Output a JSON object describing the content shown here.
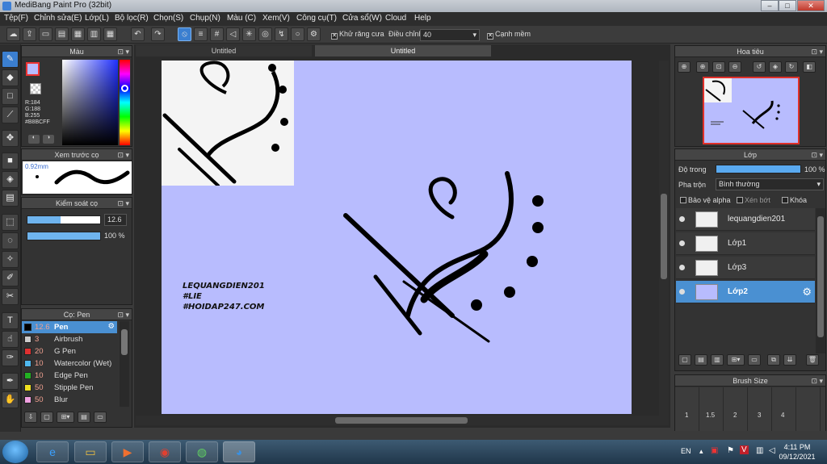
{
  "window": {
    "title": "MediBang Paint Pro (32bit)",
    "min": "–",
    "max": "□",
    "close": "✕"
  },
  "menu": [
    "Tệp(F)",
    "Chỉnh sửa(E)",
    "Lớp(L)",
    "Bộ lọc(R)",
    "Chọn(S)",
    "Chụp(N)",
    "Màu (C)",
    "Xem(V)",
    "Công cụ(T)",
    "Cửa sổ(W)",
    "Cloud",
    "Help"
  ],
  "toolbar": {
    "antialias_label": "Khử răng cưa",
    "adjust_label": "Điều chỉnh",
    "adjust_value": "40",
    "edge_label": "Cạnh mềm"
  },
  "color_panel": {
    "title": "Màu",
    "r": "R:184",
    "g": "G:188",
    "b": "B:255",
    "hex": "#B8BCFF",
    "primary_color": "#B8BCFF"
  },
  "preview_panel": {
    "title": "Xem trước cọ",
    "size": "0.92mm"
  },
  "brush_control": {
    "title": "Kiểm soát cọ",
    "size_value": "12.6",
    "opacity_value": "100 %",
    "size_fill": 0.45,
    "opacity_fill": 1.0
  },
  "brush_panel": {
    "title": "Cọ: Pen",
    "items": [
      {
        "size": "12.6",
        "name": "Pen",
        "color": "#000000"
      },
      {
        "size": "3",
        "name": "Airbrush",
        "color": "#cccccc"
      },
      {
        "size": "20",
        "name": "G Pen",
        "color": "#e03030"
      },
      {
        "size": "10",
        "name": "Watercolor (Wet)",
        "color": "#4fb8f0"
      },
      {
        "size": "10",
        "name": "Edge Pen",
        "color": "#22b022"
      },
      {
        "size": "50",
        "name": "Stipple Pen",
        "color": "#f0e020"
      },
      {
        "size": "50",
        "name": "Blur",
        "color": "#f0a0e0"
      }
    ]
  },
  "tabs": [
    "Untitled",
    "Untitled"
  ],
  "canvas_text": [
    "LEQUANGDIEN201",
    "#LIE",
    "#HOIDAP247.COM"
  ],
  "navigator": {
    "title": "Hoa tiêu"
  },
  "layers_panel": {
    "title": "Lớp",
    "opacity_label": "Độ trong",
    "opacity_value": "100 %",
    "blend_label": "Pha trộn",
    "blend_value": "Bình thường",
    "protect_alpha": "Bảo vệ alpha",
    "clipping": "Xén bớt",
    "lock": "Khóa",
    "layers": [
      {
        "name": "lequangdien201"
      },
      {
        "name": "Lớp1"
      },
      {
        "name": "Lớp3"
      },
      {
        "name": "Lớp2"
      }
    ]
  },
  "brush_size_panel": {
    "title": "Brush Size",
    "sizes": [
      "1",
      "1.5",
      "2",
      "3",
      "4"
    ]
  },
  "taskbar": {
    "lang": "EN",
    "time": "4:11 PM",
    "date": "09/12/2021"
  }
}
